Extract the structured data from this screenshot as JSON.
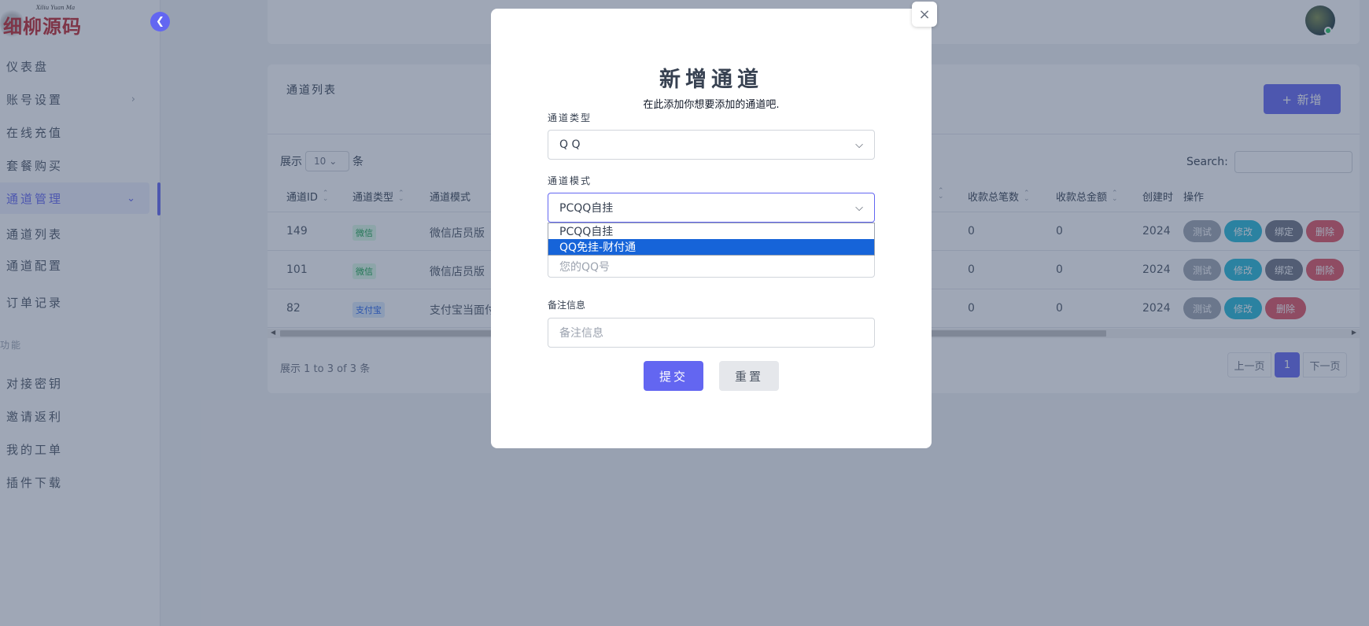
{
  "brand": {
    "logo_text": "细柳源码",
    "logo_script": "Xiliu Yuan Ma"
  },
  "sidebar": {
    "items": [
      {
        "label": "仪表盘"
      },
      {
        "label": "账号设置",
        "chevron": "›"
      },
      {
        "label": "在线充值"
      },
      {
        "label": "套餐购买"
      },
      {
        "label": "通道管理",
        "chevron": "⌄"
      },
      {
        "label": "通道列表"
      },
      {
        "label": "通道配置"
      },
      {
        "label": "订单记录"
      }
    ],
    "section_label": "功能",
    "items2": [
      {
        "label": "对接密钥"
      },
      {
        "label": "邀请返利"
      },
      {
        "label": "我的工单"
      },
      {
        "label": "插件下载"
      }
    ]
  },
  "main": {
    "card_title": "通道列表",
    "add_label": "+ 新增",
    "show_prefix": "展示",
    "page_len": "10",
    "show_suffix": "条",
    "search_label": "Search:",
    "columns": [
      "通道ID",
      "通道类型",
      "通道模式",
      "收款总笔数",
      "收款总金额",
      "创建时",
      "操作"
    ],
    "rows": [
      {
        "id": "149",
        "type": "微信",
        "mode": "微信店员版",
        "count": "0",
        "amount": "0",
        "created": "2024",
        "actions": [
          "测试",
          "修改",
          "绑定",
          "删除"
        ]
      },
      {
        "id": "101",
        "type": "微信",
        "mode": "微信店员版",
        "count": "0",
        "amount": "0",
        "created": "2024",
        "actions": [
          "测试",
          "修改",
          "绑定",
          "删除"
        ]
      },
      {
        "id": "82",
        "type": "支付宝",
        "mode": "支付宝当面付",
        "count": "0",
        "amount": "0",
        "created": "2024",
        "actions": [
          "测试",
          "修改",
          "删除"
        ]
      }
    ],
    "info": "展示 1 to 3 of 3 条",
    "pager": {
      "prev": "上一页",
      "current": "1",
      "next": "下一页"
    }
  },
  "modal": {
    "title": "新增通道",
    "subtitle": "在此添加你想要添加的通道吧.",
    "close": "×",
    "type_label": "通道类型",
    "type_value": "Q Q",
    "mode_label": "通道模式",
    "mode_value": "PCQQ自挂",
    "mode_options": [
      "PCQQ自挂",
      "QQ免挂-财付通"
    ],
    "mode_selected_index": 1,
    "account_placeholder": "您的QQ号",
    "remark_label": "备注信息",
    "remark_placeholder": "备注信息",
    "submit_label": "提交",
    "reset_label": "重置"
  },
  "colors": {
    "accent": "#6366f1",
    "overlay": "#374766",
    "danger": "#e05260",
    "info": "#22b8d6",
    "selected_option": "#1664d9"
  }
}
